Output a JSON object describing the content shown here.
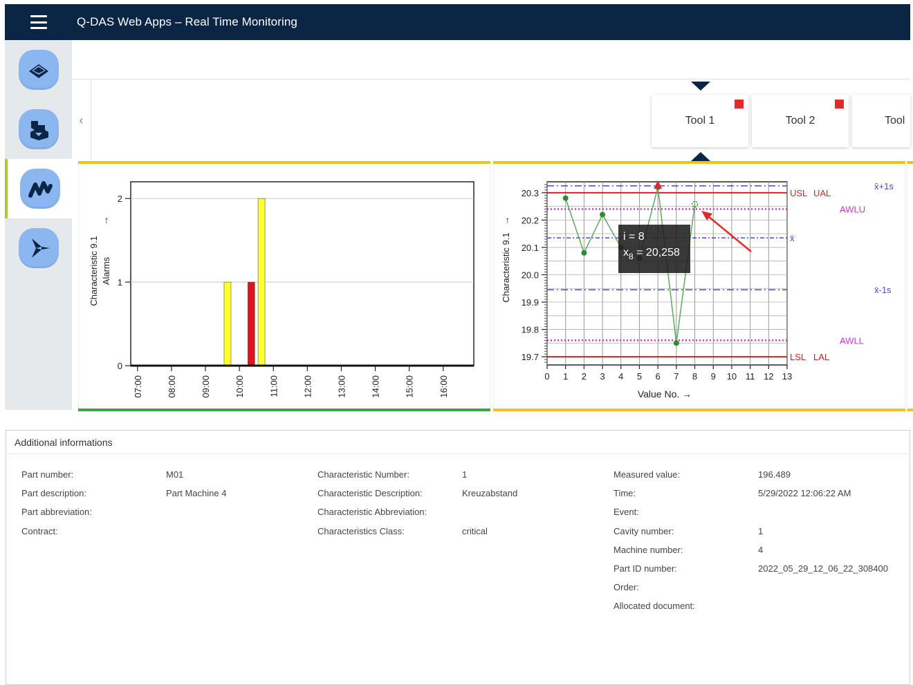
{
  "header": {
    "title": "Q-DAS Web Apps – Real Time Monitoring"
  },
  "nav": {
    "items": [
      {
        "icon": "layers-icon"
      },
      {
        "icon": "machine-icon"
      },
      {
        "icon": "monitoring-icon",
        "active": true
      },
      {
        "icon": "arrow-logo-icon"
      }
    ]
  },
  "toolbar": {
    "scroll_left": "‹",
    "tools": [
      {
        "label": "Tool 1",
        "alarm": true
      },
      {
        "label": "Tool 2",
        "alarm": true
      },
      {
        "label": "Tool"
      }
    ]
  },
  "colors": {
    "header": "#0b2545",
    "nav_button": "#8bb6f0",
    "alarm_red": "#e02b2b",
    "yellow_border": "#f2c21a",
    "green_border": "#3fa33a",
    "series_green": "#2e8b2e",
    "limit_red": "#d42020",
    "warning_magenta": "#cc33cc",
    "mean_blue": "#4848c8"
  },
  "chart_data": [
    {
      "type": "bar",
      "ylabel": "Characteristic 9.1",
      "ylabel2": "Alarms",
      "ylabel_arrow": "↑",
      "categories": [
        "07:00",
        "08:00",
        "09:00",
        "10:00",
        "11:00",
        "12:00",
        "13:00",
        "14:00",
        "15:00",
        "16:00"
      ],
      "ylim": [
        0,
        2
      ],
      "yticks": [
        "0",
        "1",
        "2"
      ],
      "xlim_hours": [
        6.8,
        16.9
      ],
      "bars": [
        {
          "hour": 9.65,
          "value": 1,
          "color": "#ffff33"
        },
        {
          "hour": 10.35,
          "value": 1,
          "color": "#e8101a"
        },
        {
          "hour": 10.65,
          "value": 2,
          "color": "#ffff33"
        }
      ],
      "grid": "horizontal"
    },
    {
      "type": "line",
      "ylabel": "Characteristic 9.1",
      "ylabel_arrow": "→",
      "xlabel": "Value No.",
      "xlabel_arrow": "→",
      "xlim": [
        0,
        13
      ],
      "ylim": [
        19.67,
        20.34
      ],
      "xticks": [
        "0",
        "1",
        "2",
        "3",
        "4",
        "5",
        "6",
        "7",
        "8",
        "9",
        "10",
        "11",
        "12",
        "13"
      ],
      "yticks": [
        "19.7",
        "19.8",
        "19.9",
        "20.0",
        "20.1",
        "20.2",
        "20.3"
      ],
      "series": [
        {
          "x": [
            1,
            2,
            3,
            4,
            5,
            6,
            7,
            8
          ],
          "y": [
            20.28,
            20.08,
            20.22,
            20.1,
            20.06,
            20.32,
            19.75,
            20.258
          ]
        }
      ],
      "limits": [
        {
          "value": 20.3,
          "labels": [
            "USL",
            "UAL"
          ],
          "style": "limit"
        },
        {
          "value": 19.7,
          "labels": [
            "LSL",
            "LAL"
          ],
          "style": "limit"
        },
        {
          "value": 20.24,
          "label": "AWLU",
          "style": "warning"
        },
        {
          "value": 19.76,
          "label": "AWLL",
          "style": "warning"
        },
        {
          "value": 20.325,
          "label": "x̄+1s",
          "style": "sigma"
        },
        {
          "value": 20.135,
          "label": "x̄",
          "style": "mean"
        },
        {
          "value": 19.945,
          "label": "x̄-1s",
          "style": "sigma"
        }
      ],
      "tooltip": {
        "line1": "i = 8",
        "line2_prefix": "x",
        "line2_sub": "8",
        "line2_suffix": " = 20,258"
      }
    }
  ],
  "info": {
    "title": "Additional informations",
    "columns": [
      [
        {
          "label": "Part number:",
          "value": "M01"
        },
        {
          "label": "Part description:",
          "value": "Part Machine 4"
        },
        {
          "label": "Part abbreviation:",
          "value": ""
        },
        {
          "label": "Contract:",
          "value": ""
        }
      ],
      [
        {
          "label": "Characteristic Number:",
          "value": "1"
        },
        {
          "label": "Characteristic Description:",
          "value": "Kreuzabstand"
        },
        {
          "label": "Characteristic Abbreviation:",
          "value": ""
        },
        {
          "label": "Characteristics Class:",
          "value": "critical"
        }
      ],
      [
        {
          "label": "Measured value:",
          "value": "196.489"
        },
        {
          "label": "Time:",
          "value": "5/29/2022 12:06:22 AM"
        },
        {
          "label": "Event:",
          "value": ""
        },
        {
          "label": "Cavity number:",
          "value": "1"
        },
        {
          "label": "Machine number:",
          "value": "4"
        },
        {
          "label": "Part ID number:",
          "value": "2022_05_29_12_06_22_308400"
        },
        {
          "label": "Order:",
          "value": ""
        },
        {
          "label": "Allocated document:",
          "value": ""
        }
      ]
    ]
  }
}
